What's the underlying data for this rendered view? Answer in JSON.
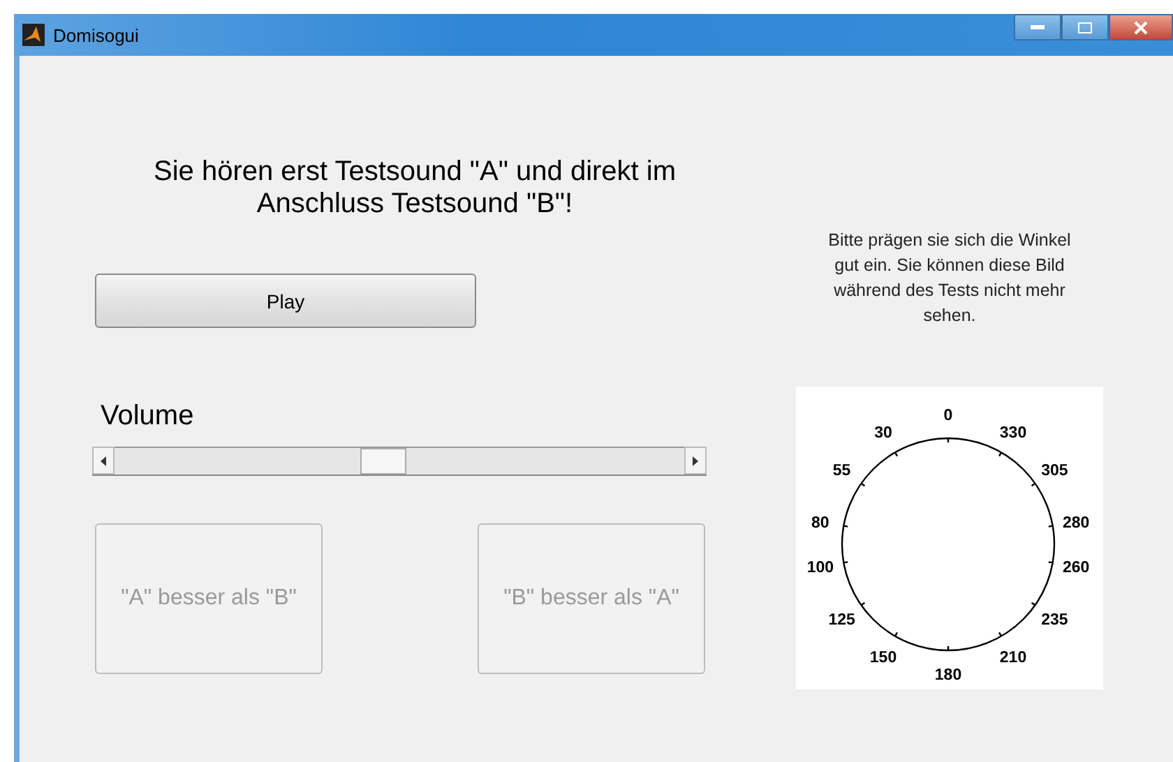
{
  "window": {
    "title": "Domisogui"
  },
  "instruction": "Sie hören erst Testsound \"A\"  und direkt im Anschluss Testsound \"B\"!",
  "play_button": {
    "label": "Play"
  },
  "volume": {
    "label": "Volume",
    "level": 0.47
  },
  "choices": [
    {
      "label": "\"A\" besser als \"B\"",
      "disabled": true
    },
    {
      "label": "\"B\" besser als \"A\"",
      "disabled": true
    }
  ],
  "hint": "Bitte prägen sie sich die Winkel gut ein. Sie können diese Bild während des Tests nicht mehr sehen.",
  "dial": {
    "labels": [
      "0",
      "30",
      "55",
      "80",
      "100",
      "125",
      "150",
      "180",
      "210",
      "235",
      "260",
      "280",
      "305",
      "330"
    ]
  }
}
